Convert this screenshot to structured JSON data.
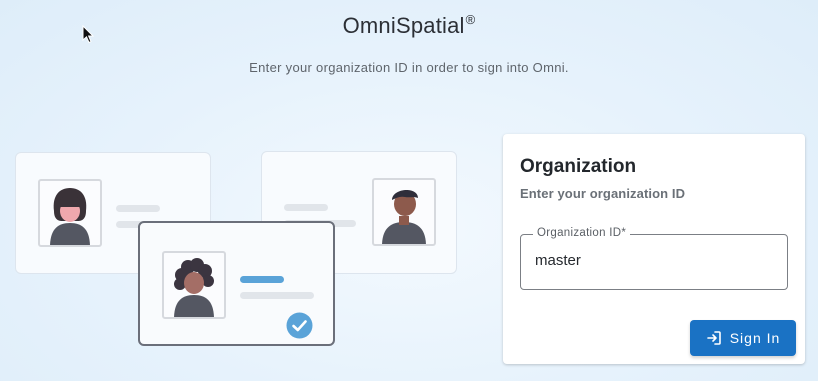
{
  "app": {
    "title": "OmniSpatial",
    "title_mark": "®",
    "subtitle": "Enter your organization ID in order to sign into Omni."
  },
  "panel": {
    "title": "Organization",
    "subtitle": "Enter your organization ID",
    "field_label": "Organization ID*",
    "field_value": "master",
    "button_label": "Sign In",
    "button_icon": "login-icon"
  },
  "colors": {
    "accent": "#1a72c4",
    "check": "#5aa3d8",
    "card_border_active": "#6b6f7a"
  }
}
